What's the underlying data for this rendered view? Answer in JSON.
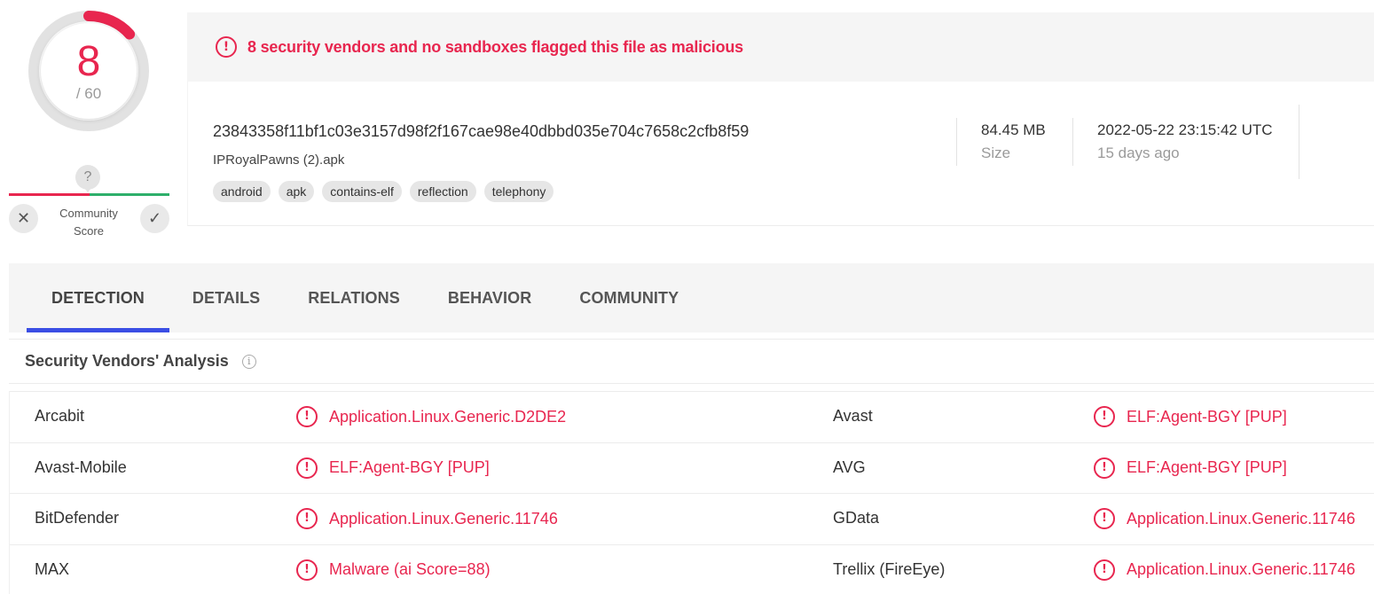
{
  "score": {
    "detections": "8",
    "total": "/ 60",
    "community": {
      "unknown_symbol": "?",
      "label": "Community Score",
      "negative_symbol": "✕",
      "positive_symbol": "✓"
    }
  },
  "banner": {
    "icon": "exclamation-circle-icon",
    "text": "8 security vendors and no sandboxes flagged this file as malicious"
  },
  "file": {
    "hash": "23843358f11bf1c03e3157d98f2f167cae98e40dbbd035e704c7658c2cfb8f59",
    "name": "IPRoyalPawns (2).apk",
    "tags": [
      "android",
      "apk",
      "contains-elf",
      "reflection",
      "telephony"
    ],
    "size_value": "84.45 MB",
    "size_label": "Size",
    "date_value": "2022-05-22 23:15:42 UTC",
    "date_relative": "15 days ago"
  },
  "tabs": [
    "DETECTION",
    "DETAILS",
    "RELATIONS",
    "BEHAVIOR",
    "COMMUNITY"
  ],
  "active_tab": "DETECTION",
  "section": {
    "title": "Security Vendors' Analysis",
    "info_icon": "info-icon"
  },
  "results": [
    {
      "left_vendor": "Arcabit",
      "left_result": "Application.Linux.Generic.D2DE2",
      "right_vendor": "Avast",
      "right_result": "ELF:Agent-BGY [PUP]"
    },
    {
      "left_vendor": "Avast-Mobile",
      "left_result": "ELF:Agent-BGY [PUP]",
      "right_vendor": "AVG",
      "right_result": "ELF:Agent-BGY [PUP]"
    },
    {
      "left_vendor": "BitDefender",
      "left_result": "Application.Linux.Generic.11746",
      "right_vendor": "GData",
      "right_result": "Application.Linux.Generic.11746"
    },
    {
      "left_vendor": "MAX",
      "left_result": "Malware (ai Score=88)",
      "right_vendor": "Trellix (FireEye)",
      "right_result": "Application.Linux.Generic.11746"
    }
  ],
  "colors": {
    "malicious": "#e8264f",
    "tab_indicator": "#3b4ee4",
    "community_positive": "#2eaf6b"
  }
}
